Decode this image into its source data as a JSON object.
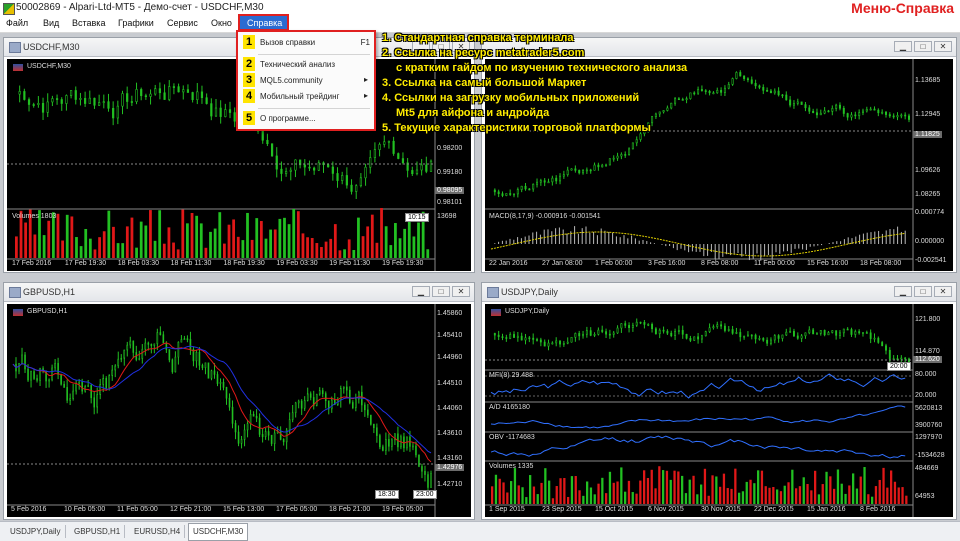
{
  "app": {
    "title": "50002869 - Alpari-Ltd-MT5 - Демо-счет - USDCHF,M30",
    "page_caption": "Меню-Справка"
  },
  "menubar": {
    "items": [
      "Файл",
      "Вид",
      "Вставка",
      "Графики",
      "Сервис",
      "Окно"
    ],
    "active": "Справка"
  },
  "dropdown": {
    "items": [
      {
        "num": "1",
        "label": "Вызов справки",
        "shortcut": "F1"
      },
      {
        "num": "2",
        "label": "Технический анализ"
      },
      {
        "num": "3",
        "label": "MQL5.community",
        "arrow": "▸"
      },
      {
        "num": "4",
        "label": "Мобильный трейдинг",
        "arrow": "▸"
      },
      {
        "num": "5",
        "label": "О программе..."
      }
    ]
  },
  "notes": [
    "1. Стандартная справка терминала",
    "2. Ссылка на ресурс metatrader5.com",
    "   с кратким гайдом по изучению технического анализа",
    "3. Ссылка на самый большой Маркет",
    "4. Ссылки на загрузку мобильных приложений",
    "   Mt5 для айфона и андройда",
    "5. Текущие характеристики торговой платформы"
  ],
  "windows": {
    "usdchf": {
      "title": "USDCHF,M30",
      "symbol": "USDCHF,M30",
      "prices": [
        "0.99180",
        "0.98101",
        "0.98200"
      ],
      "price_box": "0.98095",
      "time_box": "10:15",
      "volumes_label": "Volumes 1803",
      "vol_top": "13698",
      "times": [
        "17 Feb 2016",
        "17 Feb 19:30",
        "18 Feb 03:30",
        "18 Feb 11:30",
        "18 Feb 19:30",
        "19 Feb 03:30",
        "19 Feb 11:30",
        "19 Feb 19:30"
      ]
    },
    "right_top": {
      "prices": [
        "1.13685",
        "1.12945",
        "1.11825",
        "1.09626",
        "1.08265"
      ],
      "price_box": "1.11825",
      "macd_label": "MACD(8,17,9) -0.000916 -0.001541",
      "macd_prices": [
        "0.000774",
        "0.000000",
        "-0.002541"
      ],
      "times": [
        "22 Jan 2016",
        "27 Jan 08:00",
        "1 Feb 00:00",
        "3 Feb 16:00",
        "8 Feb 08:00",
        "11 Feb 00:00",
        "15 Feb 16:00",
        "18 Feb 08:00"
      ]
    },
    "gbpusd": {
      "title": "GBPUSD,H1",
      "symbol": "GBPUSD,H1",
      "prices": [
        "1.45860",
        "1.45410",
        "1.44960",
        "1.44510",
        "1.44060",
        "1.43610",
        "1.43160",
        "1.42710"
      ],
      "price_box": "1.42976",
      "time_boxes": [
        "18:30",
        "23:00"
      ],
      "times": [
        "5 Feb 2016",
        "10 Feb 05:00",
        "11 Feb 05:00",
        "12 Feb 21:00",
        "15 Feb 13:00",
        "17 Feb 05:00",
        "18 Feb 21:00",
        "19 Feb 05:00"
      ]
    },
    "usdjpy": {
      "title": "USDJPY,Daily",
      "symbol": "USDJPY,Daily",
      "prices": [
        "121.800",
        "114.870",
        "112.620"
      ],
      "price_box": "112.620",
      "time_box": "20:00",
      "mfi_label": "MFI(8) 29.488",
      "mfi_vals": [
        "80.000",
        "20.000"
      ],
      "ad_label": "A/D 4165180",
      "ad_vals": [
        "5620813",
        "3900760"
      ],
      "obv_label": "OBV -1174683",
      "obv_vals": [
        "1297970",
        "-1534628"
      ],
      "vol_label": "Volumes 1335",
      "vol_vals": [
        "484669",
        "64953"
      ],
      "times": [
        "1 Sep 2015",
        "23 Sep 2015",
        "15 Oct 2015",
        "6 Nov 2015",
        "30 Nov 2015",
        "22 Dec 2015",
        "15 Jan 2016",
        "8 Feb 2016"
      ]
    }
  },
  "tabs": [
    "USDJPY,Daily",
    "GBPUSD,H1",
    "EURUSD,H4",
    "USDCHF,M30"
  ],
  "active_tab": "USDCHF,M30",
  "colors": {
    "bull": "#22c022",
    "bear": "#e01818",
    "accent": "#2a6bd1",
    "highlight": "#ffe400",
    "frame": "#e02020"
  }
}
